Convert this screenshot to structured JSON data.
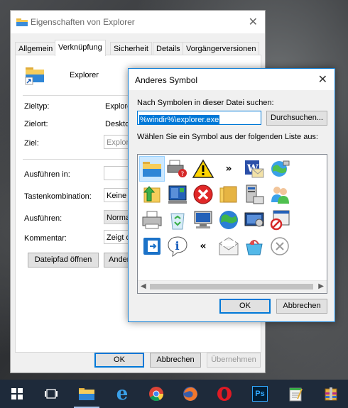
{
  "properties_window": {
    "title": "Eigenschaften von Explorer",
    "tabs": [
      "Allgemein",
      "Verknüpfung",
      "Sicherheit",
      "Details",
      "Vorgängerversionen"
    ],
    "active_tab": "Verknüpfung",
    "item_name": "Explorer",
    "fields": {
      "zieltyp_label": "Zieltyp:",
      "zieltyp_value": "Explore",
      "zielort_label": "Zielort:",
      "zielort_value": "Desktop",
      "ziel_label": "Ziel:",
      "ziel_value": "Explore",
      "ausfuehren_in_label": "Ausführen in:",
      "ausfuehren_in_value": "",
      "tastenkombination_label": "Tastenkombination:",
      "tastenkombination_value": "Keine",
      "ausfuehren_label": "Ausführen:",
      "ausfuehren_value": "Norma",
      "kommentar_label": "Kommentar:",
      "kommentar_value": "Zeigt d"
    },
    "buttons": {
      "dateipfad": "Dateipfad öffnen",
      "anderes": "Ander",
      "ok": "OK",
      "abbrechen": "Abbrechen",
      "uebernehmen": "Übernehmen"
    }
  },
  "change_icon_dialog": {
    "title": "Anderes Symbol",
    "search_label": "Nach Symbolen in dieser Datei suchen:",
    "file_path": "%windir%\\explorer.exe",
    "browse_button": "Durchsuchen...",
    "list_label": "Wählen Sie ein Symbol aus der folgenden Liste aus:",
    "ok_button": "OK",
    "cancel_button": "Abbrechen",
    "icons": [
      "folder-icon",
      "printer-network-icon",
      "warning-icon",
      "fast-forward-icon",
      "word-mail-icon",
      "internet-globe-icon",
      "folder-up-arrow-icon",
      "network-computer-icon",
      "error-icon",
      "folder-closed-icon",
      "system-properties-icon",
      "users-icon",
      "printer-icon",
      "recycle-bin-icon",
      "computer-icon",
      "globe-icon",
      "display-settings-icon",
      "blocked-window-icon",
      "exit-icon",
      "info-bubble-icon",
      "rewind-icon",
      "envelope-icon",
      "shopping-basket-icon",
      "close-circle-icon"
    ],
    "selected_icon": "folder-icon"
  },
  "taskbar": {
    "items": [
      "windows-start-icon",
      "task-view-icon",
      "file-explorer-icon",
      "internet-explorer-icon",
      "chrome-icon",
      "firefox-icon",
      "opera-icon",
      "photoshop-icon",
      "notepad-icon",
      "winrar-icon"
    ],
    "photoshop_label": "Ps"
  },
  "colors": {
    "accent": "#0078d7",
    "selection": "#cce8ff",
    "taskbar": "#1e2a3a"
  }
}
